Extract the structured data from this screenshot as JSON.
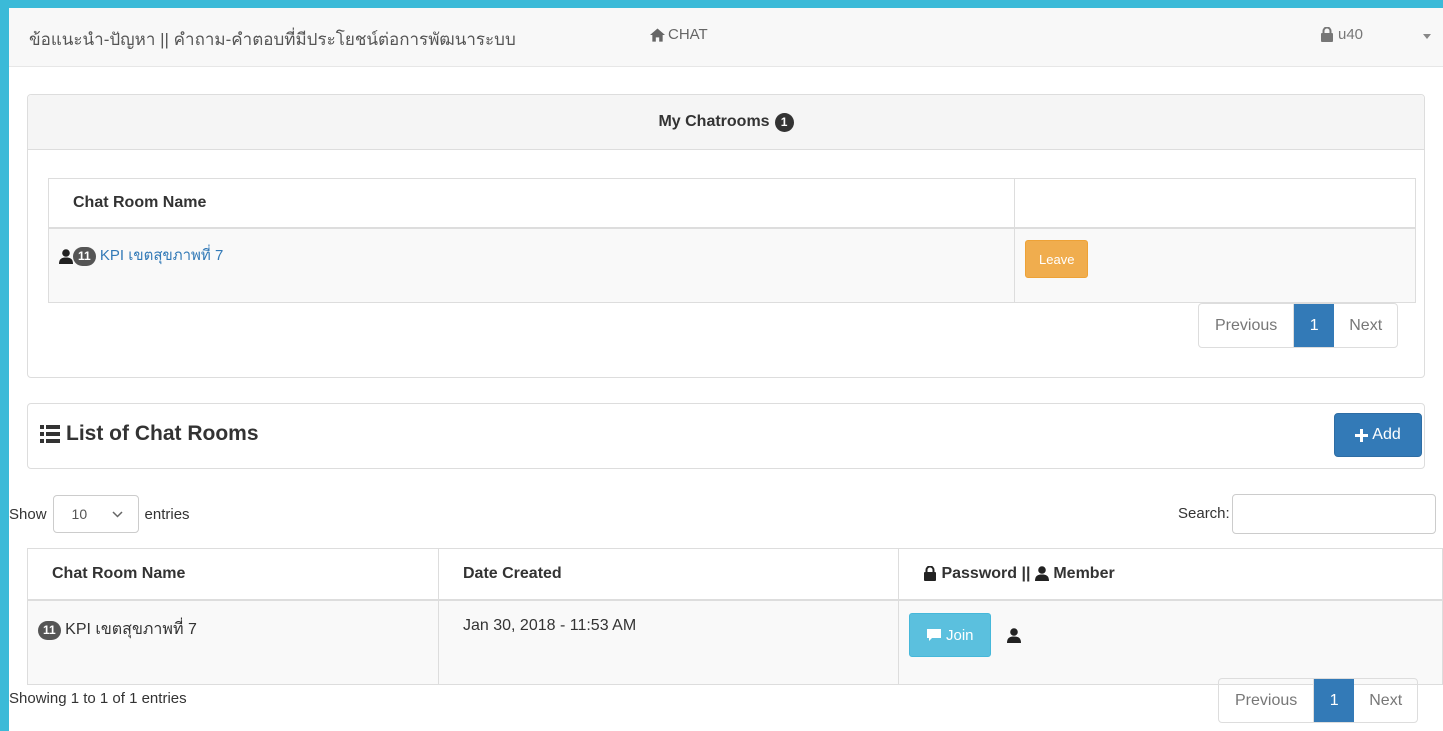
{
  "navbar": {
    "brand": "ข้อแนะนำ-ปัญหา || คำถาม-คำตอบที่มีประโยชน์ต่อการพัฒนาระบบ",
    "chat_link": "CHAT",
    "user": "u40"
  },
  "my_chatrooms": {
    "title": "My Chatrooms",
    "count": "1",
    "columns": [
      "Chat Room Name",
      ""
    ],
    "rows": [
      {
        "members": "11",
        "name": "KPI เขตสุขภาพที่ 7",
        "action": "Leave"
      }
    ],
    "pagination": {
      "previous": "Previous",
      "page": "1",
      "next": "Next"
    }
  },
  "list": {
    "title": "List of Chat Rooms",
    "add_label": "Add",
    "show_label": "Show",
    "entries_value": "10",
    "entries_label": "entries",
    "search_label": "Search:",
    "search_value": "",
    "columns": [
      "Chat Room Name",
      "Date Created",
      "Password || ",
      "Member"
    ],
    "rows": [
      {
        "members": "11",
        "name": "KPI เขตสุขภาพที่ 7",
        "date": "Jan 30, 2018 - 11:53 AM",
        "action": "Join"
      }
    ],
    "info": "Showing 1 to 1 of 1 entries",
    "pagination": {
      "previous": "Previous",
      "page": "1",
      "next": "Next"
    }
  },
  "colors": {
    "frame": "#3bbad8",
    "primary": "#337ab7",
    "warning": "#f0ad4e",
    "info": "#5bc0de"
  },
  "icons": [
    "home-icon",
    "lock-icon",
    "caret-down-icon",
    "user-icon",
    "list-icon",
    "plus-icon",
    "comment-icon"
  ]
}
